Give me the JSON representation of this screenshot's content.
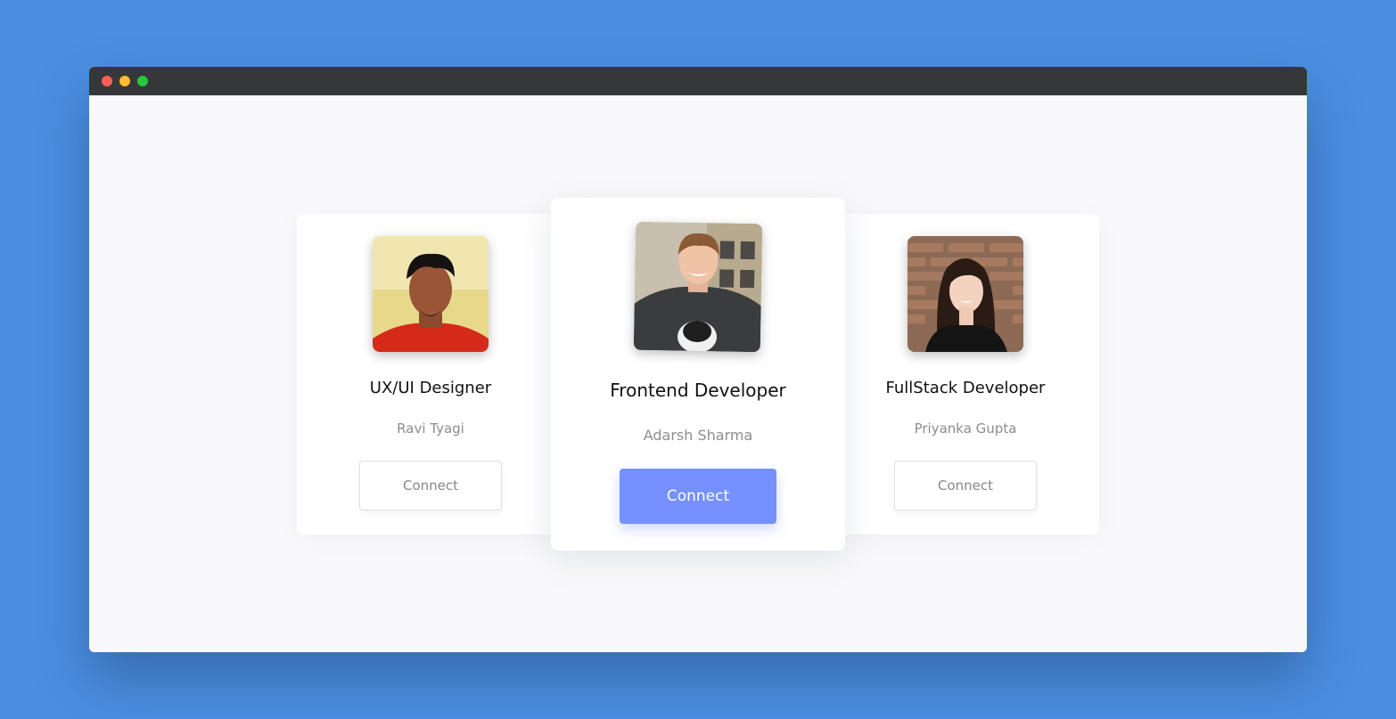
{
  "window": {
    "controls": [
      "close",
      "minimize",
      "maximize"
    ]
  },
  "cards": [
    {
      "role": "UX/UI Designer",
      "name": "Ravi Tyagi",
      "button": "Connect"
    },
    {
      "role": "Frontend Developer",
      "name": "Adarsh Sharma",
      "button": "Connect"
    },
    {
      "role": "FullStack Developer",
      "name": "Priyanka Gupta",
      "button": "Connect"
    }
  ],
  "colors": {
    "background": "#4a8fe0",
    "titlebar": "#363739",
    "accent_button": "#7590ff",
    "close": "#fe5f57",
    "minimize": "#febc2e",
    "maximize": "#27c840"
  }
}
